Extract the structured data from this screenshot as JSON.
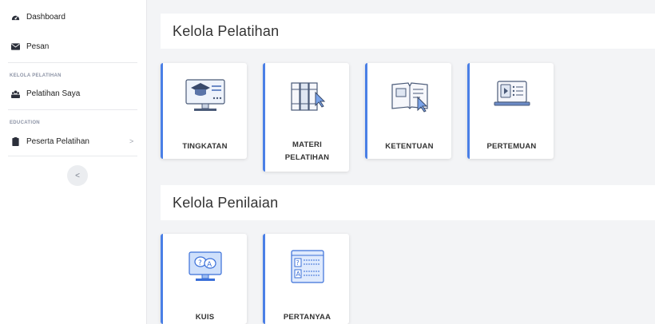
{
  "sidebar": {
    "items": [
      {
        "label": "Dashboard",
        "icon": "dashboard-icon"
      },
      {
        "label": "Pesan",
        "icon": "envelope-icon"
      },
      {
        "label": "Pelatihan Saya",
        "icon": "users-icon"
      },
      {
        "label": "Peserta Pelatihan",
        "icon": "clipboard-icon"
      }
    ],
    "sections": [
      {
        "label": "KELOLA PELATIHAN"
      },
      {
        "label": "EDUCATION"
      }
    ],
    "chevron": ">",
    "collapse": "<"
  },
  "main": {
    "sections": [
      {
        "title": "Kelola Pelatihan",
        "cards": [
          {
            "label": "TINGKATAN",
            "icon": "graduation-monitor-icon"
          },
          {
            "label": "MATERI",
            "label2": "PELATIHAN",
            "icon": "books-icon"
          },
          {
            "label": "KETENTUAN",
            "icon": "open-book-icon"
          },
          {
            "label": "PERTEMUAN",
            "icon": "video-lesson-icon"
          }
        ]
      },
      {
        "title": "Kelola Penilaian",
        "cards": [
          {
            "label": "KUIS",
            "icon": "quiz-monitor-icon"
          },
          {
            "label": "PERTANYAA",
            "icon": "question-form-icon"
          }
        ]
      }
    ]
  },
  "colors": {
    "accent": "#4a7fe6",
    "sidebar_bg": "#ffffff",
    "content_bg": "#f3f4f6"
  }
}
